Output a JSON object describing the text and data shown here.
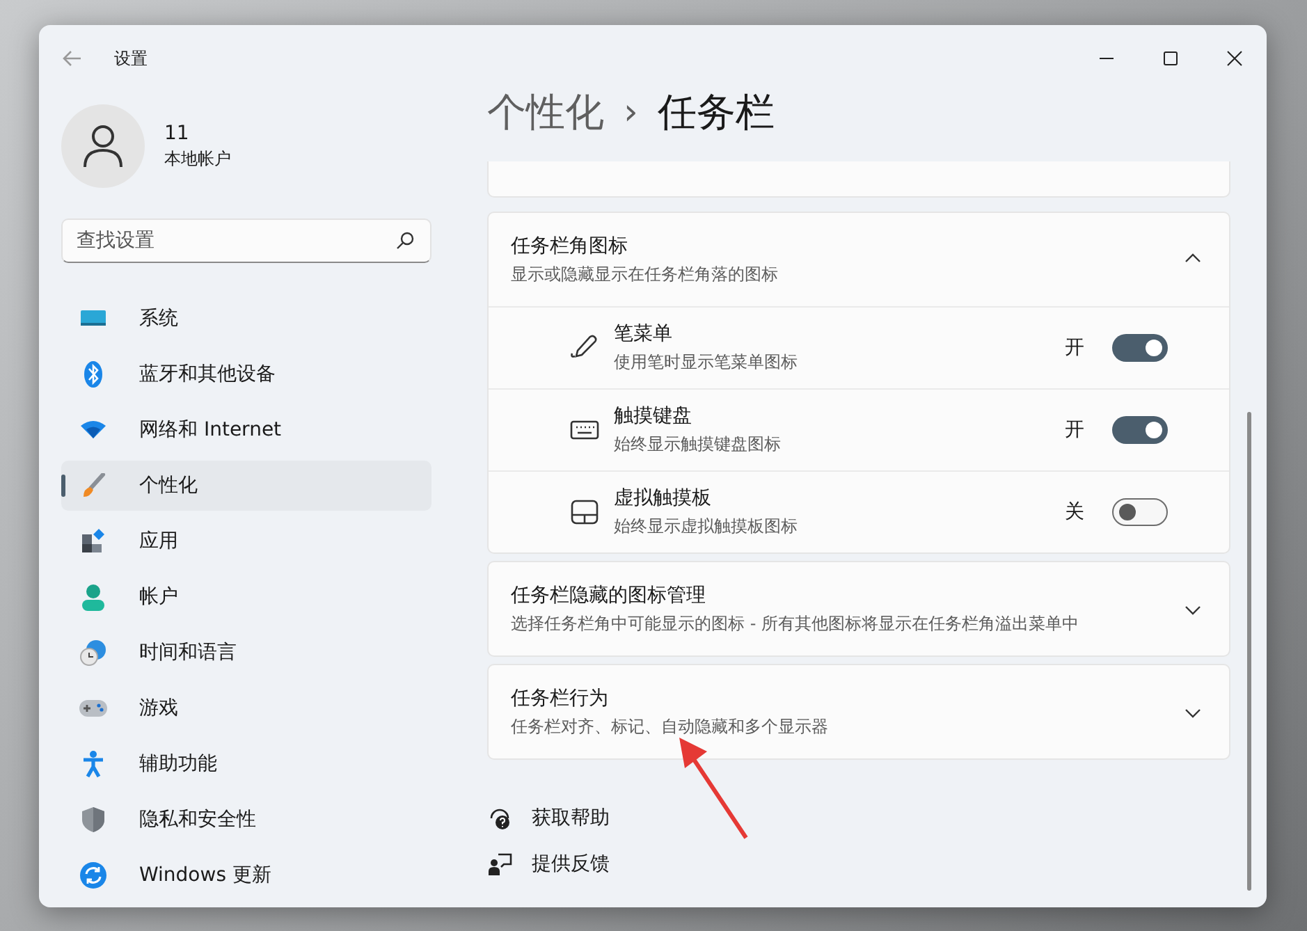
{
  "window": {
    "title": "设置"
  },
  "account": {
    "name": "11",
    "type": "本地帐户"
  },
  "search": {
    "placeholder": "查找设置"
  },
  "nav": [
    {
      "label": "系统",
      "selected": false
    },
    {
      "label": "蓝牙和其他设备",
      "selected": false
    },
    {
      "label": "网络和 Internet",
      "selected": false
    },
    {
      "label": "个性化",
      "selected": true
    },
    {
      "label": "应用",
      "selected": false
    },
    {
      "label": "帐户",
      "selected": false
    },
    {
      "label": "时间和语言",
      "selected": false
    },
    {
      "label": "游戏",
      "selected": false
    },
    {
      "label": "辅助功能",
      "selected": false
    },
    {
      "label": "隐私和安全性",
      "selected": false
    },
    {
      "label": "Windows 更新",
      "selected": false
    }
  ],
  "breadcrumb": {
    "parent": "个性化",
    "separator": "›",
    "current": "任务栏"
  },
  "sections": [
    {
      "title": "任务栏角图标",
      "subtitle": "显示或隐藏显示在任务栏角落的图标",
      "expanded": true,
      "items": [
        {
          "label": "笔菜单",
          "description": "使用笔时显示笔菜单图标",
          "state_text": "开",
          "on": true
        },
        {
          "label": "触摸键盘",
          "description": "始终显示触摸键盘图标",
          "state_text": "开",
          "on": true
        },
        {
          "label": "虚拟触摸板",
          "description": "始终显示虚拟触摸板图标",
          "state_text": "关",
          "on": false
        }
      ]
    },
    {
      "title": "任务栏隐藏的图标管理",
      "subtitle": "选择任务栏角中可能显示的图标 - 所有其他图标将显示在任务栏角溢出菜单中",
      "expanded": false
    },
    {
      "title": "任务栏行为",
      "subtitle": "任务栏对齐、标记、自动隐藏和多个显示器",
      "expanded": false
    }
  ],
  "links": [
    {
      "label": "获取帮助"
    },
    {
      "label": "提供反馈"
    }
  ]
}
